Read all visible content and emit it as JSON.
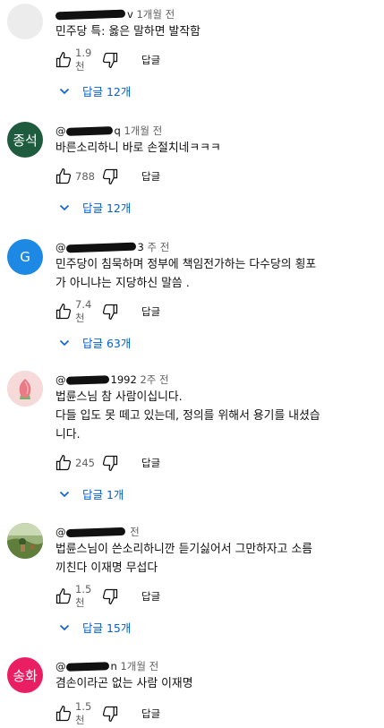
{
  "icons": {
    "like": "thumbs-up-icon",
    "dislike": "thumbs-down-icon",
    "expand": "chevron-down-icon"
  },
  "colors": {
    "reply_link": "#065fd4",
    "meta": "#606060"
  },
  "comments": [
    {
      "handle_suffix": "v",
      "time": "1개월 전",
      "lines": [
        "민주당 특: 옳은 말하면 발작함"
      ],
      "likes": "1.9천",
      "reply_label": "답글",
      "replies": "답글 12개",
      "avatar_text": ""
    },
    {
      "handle_suffix": "@",
      "handle_end": "q",
      "time": "1개월 전",
      "lines": [
        "바른소리하니 바로 손절치네ㅋㅋㅋ"
      ],
      "likes": "788",
      "reply_label": "답글",
      "replies": "답글 12개",
      "avatar_text": "종석"
    },
    {
      "handle_suffix": "@",
      "handle_end": "3",
      "time": "주 전",
      "lines": [
        "민주당이 침묵하며 정부에 책임전가하는  다수당의 횡포",
        "가 아니냐는 지당하신 말씀 ."
      ],
      "likes": "7.4천",
      "reply_label": "답글",
      "replies": "답글 63개",
      "avatar_text": "G"
    },
    {
      "handle_suffix": "@",
      "handle_end": "1992",
      "time": "2주 전",
      "lines": [
        "법륜스님 참 사람이십니다.",
        "다들 입도 못 떼고 있는데, 정의를 위해서  용기를 내셨습",
        "니다."
      ],
      "likes": "245",
      "reply_label": "답글",
      "replies": "답글 1개",
      "avatar_text": ""
    },
    {
      "handle_suffix": "@",
      "handle_end": "",
      "time": "전",
      "lines": [
        "법륜스님이 쓴소리하니깐   듣기싫어서 그만하자고   소름",
        "끼친다  이재명    무섭다"
      ],
      "likes": "1.5천",
      "reply_label": "답글",
      "replies": "답글 15개",
      "avatar_text": ""
    },
    {
      "handle_suffix": "@",
      "handle_end": "n",
      "time": "1개월 전",
      "lines": [
        "겸손이라곤 없는 사람  이재명"
      ],
      "likes": "1.5천",
      "reply_label": "답글",
      "replies": "",
      "avatar_text": "송화"
    }
  ]
}
